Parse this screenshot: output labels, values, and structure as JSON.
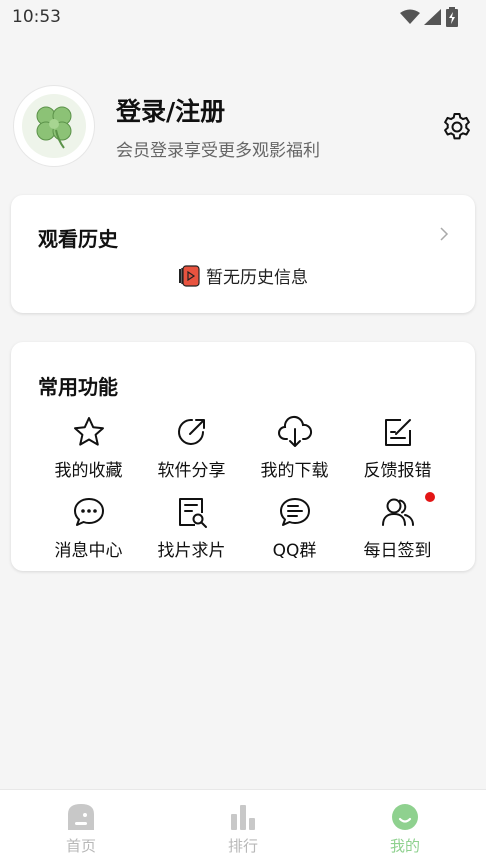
{
  "status_bar": {
    "time": "10:53"
  },
  "profile": {
    "title": "登录/注册",
    "subtitle": "会员登录享受更多观影福利"
  },
  "history": {
    "title": "观看历史",
    "empty_text": "暂无历史信息"
  },
  "functions": {
    "title": "常用功能",
    "items": [
      {
        "label": "我的收藏",
        "icon": "star-icon"
      },
      {
        "label": "软件分享",
        "icon": "share-icon"
      },
      {
        "label": "我的下载",
        "icon": "cloud-download-icon"
      },
      {
        "label": "反馈报错",
        "icon": "feedback-icon"
      },
      {
        "label": "消息中心",
        "icon": "message-icon"
      },
      {
        "label": "找片求片",
        "icon": "search-document-icon"
      },
      {
        "label": "QQ群",
        "icon": "chat-group-icon"
      },
      {
        "label": "每日签到",
        "icon": "users-icon",
        "badge": true
      }
    ]
  },
  "bottom_nav": {
    "items": [
      {
        "label": "首页",
        "icon": "home-icon"
      },
      {
        "label": "排行",
        "icon": "bar-chart-icon"
      },
      {
        "label": "我的",
        "icon": "smile-icon",
        "active": true
      }
    ]
  },
  "colors": {
    "accent": "#8fd18f",
    "badge": "#e31515",
    "history_icon": "#e8533f"
  }
}
